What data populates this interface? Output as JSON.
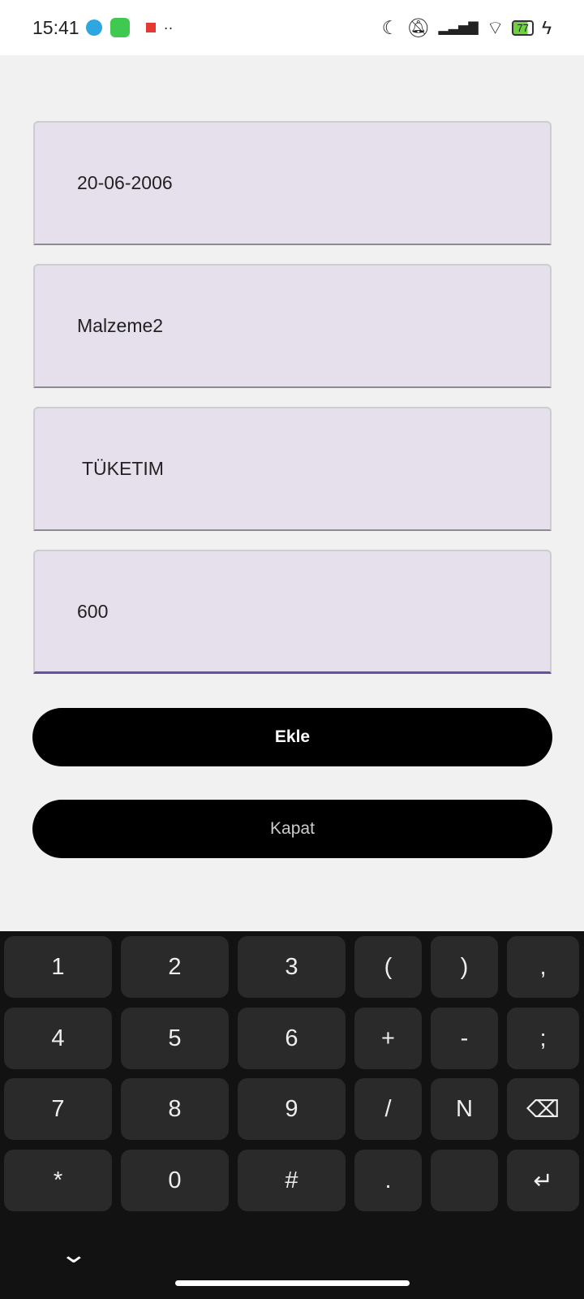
{
  "status_bar": {
    "time": "15:41",
    "battery": "77"
  },
  "form": {
    "date": "20-06-2006",
    "material": "Malzeme2",
    "type": " TÜKETIM",
    "amount": "600"
  },
  "buttons": {
    "add": "Ekle",
    "close": "Kapat"
  },
  "keyboard": {
    "rows": [
      [
        "1",
        "2",
        "3",
        "(",
        ")",
        ","
      ],
      [
        "4",
        "5",
        "6",
        "+",
        "-",
        ";"
      ],
      [
        "7",
        "8",
        "9",
        "/",
        "N",
        "⌫"
      ],
      [
        "*",
        "0",
        "#",
        ".",
        "",
        "↵"
      ]
    ]
  }
}
